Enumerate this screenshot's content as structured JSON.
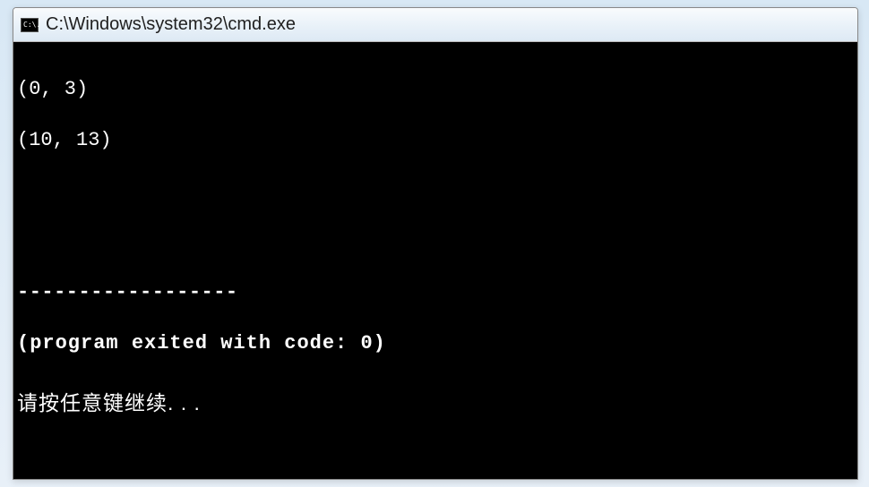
{
  "window": {
    "icon_text": "C:\\.",
    "title": "C:\\Windows\\system32\\cmd.exe"
  },
  "console": {
    "line1": "(0, 3)",
    "line2": "(10, 13)",
    "separator": "------------------",
    "exit_msg": "(program exited with code: 0)",
    "prompt": "请按任意键继续. . ."
  }
}
